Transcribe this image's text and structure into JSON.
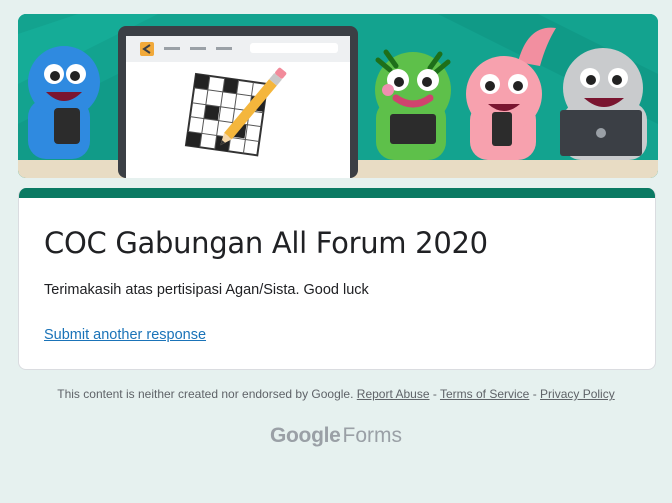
{
  "form": {
    "title": "COC Gabungan All Forum 2020",
    "message": "Terimakasih atas pertisipasi Agan/Sista. Good luck",
    "submit_another_label": "Submit another response"
  },
  "footer": {
    "disclaimer": "This content is neither created nor endorsed by Google.",
    "report_abuse": "Report Abuse",
    "sep1": "-",
    "terms": "Terms of Service",
    "sep2": "-",
    "privacy": "Privacy Policy"
  },
  "brand": {
    "google": "Google",
    "forms": "Forms"
  },
  "colors": {
    "background": "#e6f1ef",
    "accent": "#0b7a63",
    "link": "#1a73b8",
    "banner": "#13a38f"
  }
}
